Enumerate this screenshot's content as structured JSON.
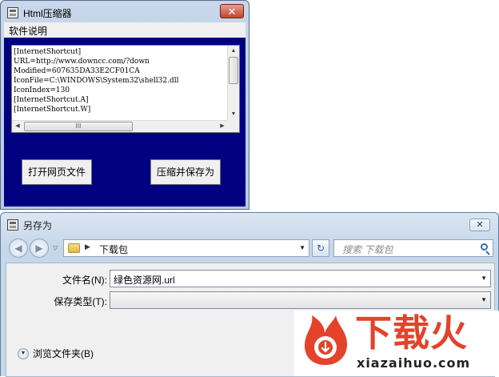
{
  "window1": {
    "title": "Html压缩器",
    "close_glyph": "✕",
    "menu": [
      "软件说明"
    ],
    "textarea_lines": [
      "[InternetShortcut]",
      "URL=http://www.downcc.com/?down",
      "Modified=607635DA33E2CF01CA",
      "IconFile=C:\\WINDOWS\\System32\\shell32.dll",
      "IconIndex=130",
      "[InternetShortcut.A]",
      "[InternetShortcut.W]"
    ],
    "scroll_glyphs": {
      "up": "▲",
      "down": "▼",
      "left": "◀",
      "right": "▶",
      "grip": "III"
    },
    "buttons": {
      "open": "打开网页文件",
      "save": "压缩并保存为"
    }
  },
  "save_dialog": {
    "title": "另存为",
    "close_glyph": "✕",
    "nav": {
      "back_glyph": "◀",
      "forward_glyph": "▶",
      "dropdown_glyph": "▽"
    },
    "address": {
      "separator": "▶",
      "path": "下载包",
      "dropdown_glyph": "▼"
    },
    "refresh_glyph": "↻",
    "search_placeholder": "搜索 下载包",
    "filename_label": "文件名(N):",
    "filename_value": "绿色资源网.url",
    "filetype_label": "保存类型(T):",
    "filetype_value": "",
    "combo_dropdown_glyph": "▼",
    "browse_label": "浏览文件夹(B)",
    "browse_glyph": "▼"
  },
  "watermark": {
    "logo_text": "下载火",
    "logo_subtext": "xiazaihuo.com"
  },
  "colors": {
    "client_bg": "#000080",
    "watermark_red": "#e4422b"
  }
}
